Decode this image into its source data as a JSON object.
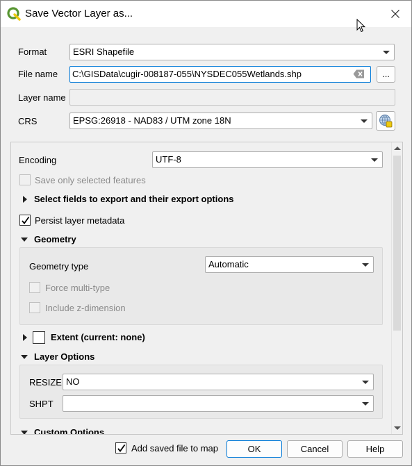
{
  "window": {
    "title": "Save Vector Layer as..."
  },
  "form": {
    "format_label": "Format",
    "format_value": "ESRI Shapefile",
    "filename_label": "File name",
    "filename_value": "C:\\GISData\\cugir-008187-055\\NYSDEC055Wetlands.shp",
    "browse_label": "...",
    "layername_label": "Layer name",
    "layername_value": "",
    "crs_label": "CRS",
    "crs_value": "EPSG:26918 - NAD83 / UTM zone 18N"
  },
  "options": {
    "encoding_label": "Encoding",
    "encoding_value": "UTF-8",
    "save_selected_label": "Save only selected features",
    "select_fields_label": "Select fields to export and their export options",
    "persist_metadata_label": "Persist layer metadata",
    "persist_metadata_checked": true,
    "geometry_section": "Geometry",
    "geometry_type_label": "Geometry type",
    "geometry_type_value": "Automatic",
    "force_multi_label": "Force multi-type",
    "include_z_label": "Include z-dimension",
    "extent_label": "Extent (current: none)",
    "layer_options_section": "Layer Options",
    "resize_label": "RESIZE",
    "resize_value": "NO",
    "shpt_label": "SHPT",
    "shpt_value": "",
    "custom_options_section": "Custom Options"
  },
  "footer": {
    "add_to_map_label": "Add saved file to map",
    "add_to_map_checked": true,
    "ok_label": "OK",
    "cancel_label": "Cancel",
    "help_label": "Help"
  },
  "colors": {
    "accent": "#0078d7",
    "qgis_green": "#589632",
    "qgis_yellow": "#eec90d"
  }
}
